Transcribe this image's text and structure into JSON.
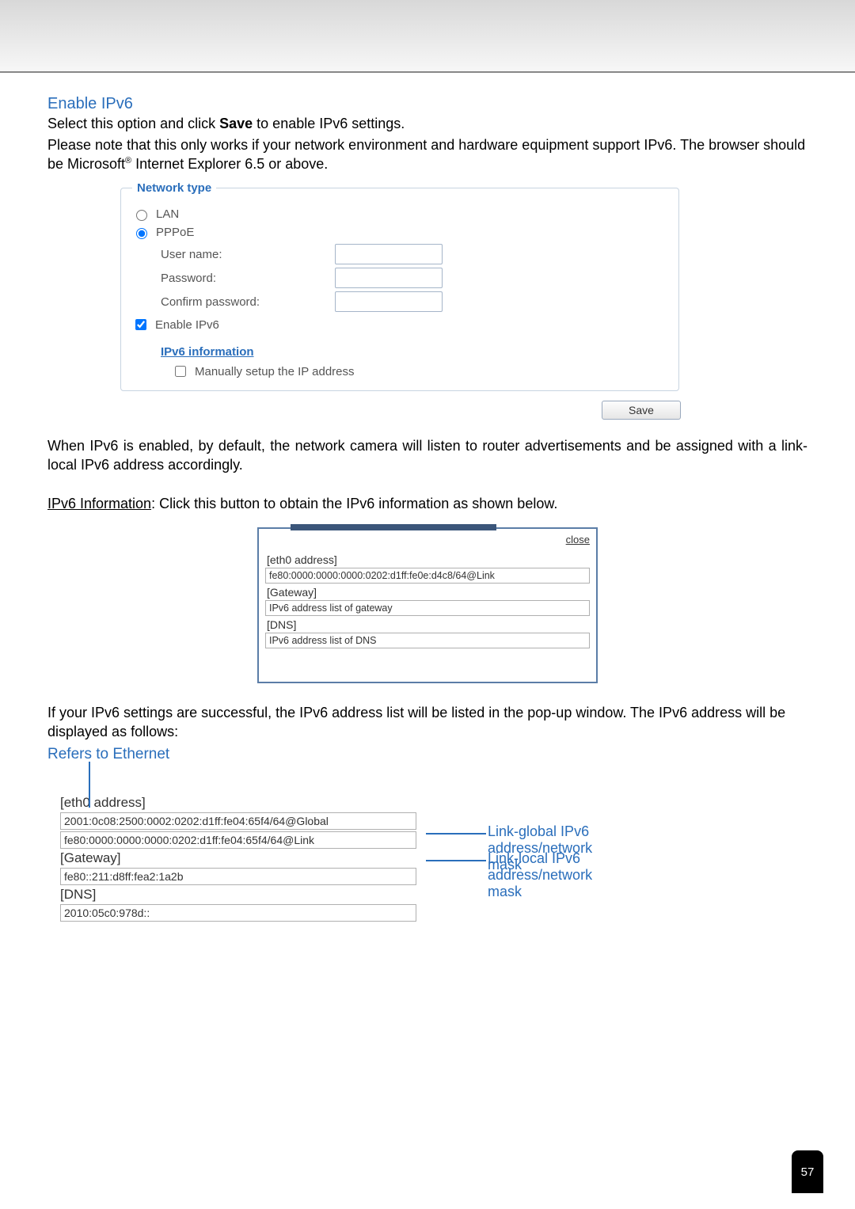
{
  "page_number": "57",
  "heading_enable_ipv6": "Enable IPv6",
  "intro_line1_pre": "Select this option and click ",
  "intro_line1_bold": "Save",
  "intro_line1_post": " to enable IPv6 settings.",
  "intro_line2": "Please note that this only works if your network environment and hardware equipment support IPv6. The browser should be Microsoft",
  "intro_line2_sup": "®",
  "intro_line2_post": " Internet Explorer 6.5 or above.",
  "fieldset": {
    "legend": "Network type",
    "lan_label": "LAN",
    "pppoe_label": "PPPoE",
    "username_label": "User name:",
    "password_label": "Password:",
    "confirm_label": "Confirm password:",
    "enable_ipv6_label": "Enable IPv6",
    "ipv6_info_link": "IPv6 information",
    "manual_label": "Manually setup the IP address"
  },
  "save_button": "Save",
  "para_after_fieldset": "When IPv6 is enabled, by default, the network camera will listen to router advertisements and be assigned with a link-local IPv6 address accordingly.",
  "ipv6_info_underline": "IPv6 Information",
  "ipv6_info_rest": ": Click this button to obtain the IPv6 information as shown below.",
  "popup": {
    "close": "close",
    "eth0_label": "[eth0 address]",
    "eth0_value": "fe80:0000:0000:0000:0202:d1ff:fe0e:d4c8/64@Link",
    "gateway_label": "[Gateway]",
    "gateway_value": "IPv6 address list of gateway",
    "dns_label": "[DNS]",
    "dns_value": "IPv6 address list of DNS"
  },
  "para_after_popup": "If your IPv6 settings are successful, the IPv6 address list will be listed in the pop-up window. The IPv6 address will be displayed as follows:",
  "refers_to_ethernet": "Refers to Ethernet",
  "eth": {
    "eth0_label_pre": "[eth0",
    "eth0_label_post": "address]",
    "global_value": "2001:0c08:2500:0002:0202:d1ff:fe04:65f4/64@Global",
    "link_value": "fe80:0000:0000:0000:0202:d1ff:fe04:65f4/64@Link",
    "gateway_label": "[Gateway]",
    "gateway_value": "fe80::211:d8ff:fea2:1a2b",
    "dns_label": "[DNS]",
    "dns_value": "2010:05c0:978d::"
  },
  "annotations": {
    "link_global": "Link-global IPv6 address/network mask",
    "link_local": "Link-local IPv6 address/network mask"
  }
}
